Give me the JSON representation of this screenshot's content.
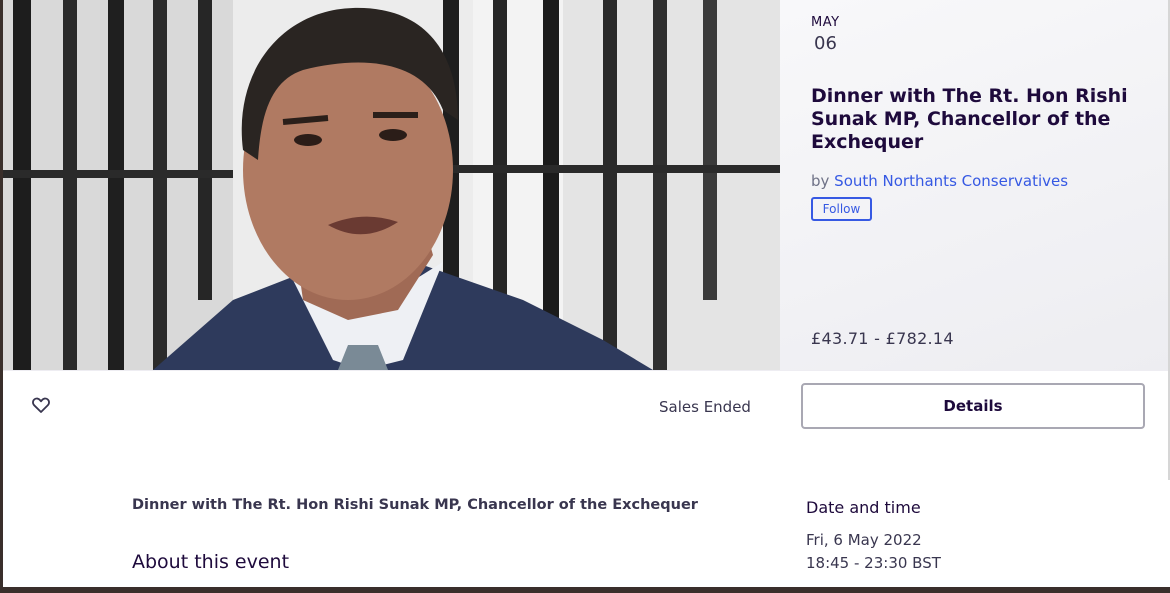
{
  "hero": {
    "image_alt": "photo of a man in a dark suit in front of black railings"
  },
  "info_panel": {
    "month": "MAY",
    "day": "06",
    "title": "Dinner with The Rt. Hon Rishi Sunak MP, Chancellor of the Exchequer",
    "organizer_prefix": "by ",
    "organizer_name": "South Northants Conservatives",
    "follow_label": "Follow",
    "price": "£43.71 - £782.14"
  },
  "action_bar": {
    "icons": {
      "like": "heart-outline-icon"
    },
    "sales_status": "Sales Ended",
    "details_label": "Details"
  },
  "body": {
    "title": "Dinner with The Rt. Hon Rishi Sunak MP, Chancellor of the Exchequer",
    "about_heading": "About this event",
    "date_heading": "Date and time",
    "date_line": "Fri, 6 May 2022",
    "time_line": "18:45 - 23:30 BST"
  },
  "colors": {
    "link": "#3659e3",
    "heading": "#1e0a3c",
    "text": "#39364f",
    "border": "#a9a8b3"
  }
}
